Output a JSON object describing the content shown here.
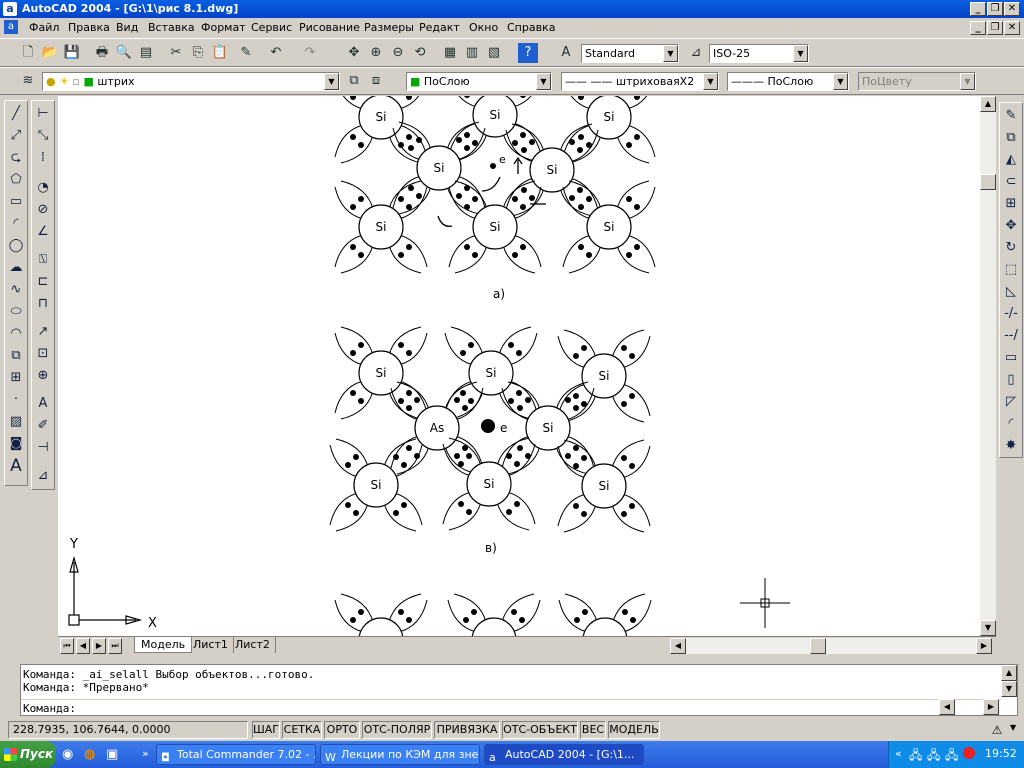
{
  "title": {
    "app_icon": "a",
    "text": "AutoCAD 2004 - [G:\\1\\рис 8.1.dwg]"
  },
  "menu": [
    {
      "label": "Файл",
      "icon": "a"
    },
    {
      "label": "Правка"
    },
    {
      "label": "Вид"
    },
    {
      "label": "Вставка"
    },
    {
      "label": "Формат"
    },
    {
      "label": "Сервис"
    },
    {
      "label": "Рисование"
    },
    {
      "label": "Размеры"
    },
    {
      "label": "Редакт"
    },
    {
      "label": "Окно"
    },
    {
      "label": "Справка"
    }
  ],
  "toolbar": {
    "text_style": "Standard",
    "dim_style": "ISO-25",
    "layer": "штрих",
    "color": "ПоСлою",
    "linetype": "штриховаяX2",
    "lineweight": "ПоСлою",
    "plotstyle": "ПоЦвету"
  },
  "drawing": {
    "atom_a": "Si",
    "atom_b_center": "As",
    "electron": "e",
    "label_a": "а)",
    "label_b": "в)",
    "ucs_x": "X",
    "ucs_y": "Y"
  },
  "tabs": [
    "Модель",
    "Лист1",
    "Лист2"
  ],
  "command": {
    "line1": "Команда: _ai_selall Выбор объектов...готово.",
    "line2": "Команда: *Прервано*",
    "prompt": "Команда:"
  },
  "status": {
    "coords": "228.7935, 106.7644, 0.0000",
    "buttons": [
      "ШАГ",
      "СЕТКА",
      "ОРТО",
      "ОТС-ПОЛЯР",
      "ПРИВЯЗКА",
      "ОТС-ОБЪЕКТ",
      "ВЕС",
      "МОДЕЛЬ"
    ]
  },
  "taskbar": {
    "start": "Пуск",
    "tasks": [
      {
        "label": "Total Commander 7.02 - ..."
      },
      {
        "label": "Лекции по КЭМ для зне..."
      },
      {
        "label": "AutoCAD 2004 - [G:\\1..."
      }
    ],
    "clock": "19:52"
  }
}
